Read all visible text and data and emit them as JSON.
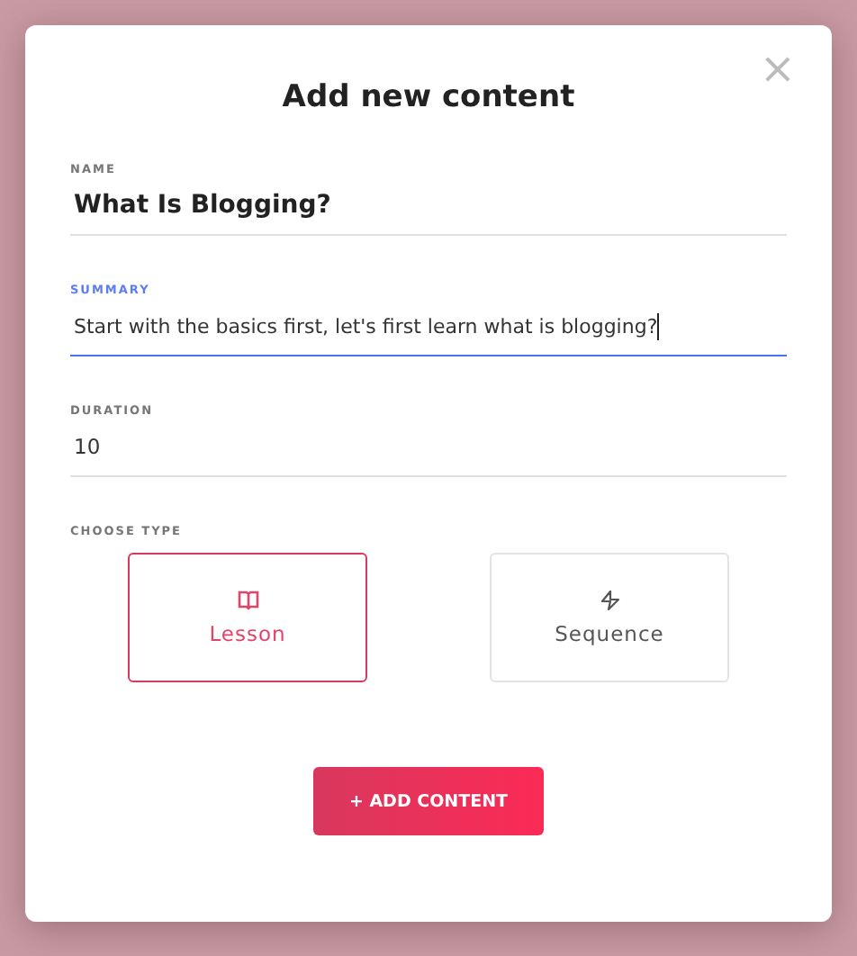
{
  "dialog": {
    "title": "Add new content",
    "close": "×"
  },
  "fields": [
    {
      "label": "NAME",
      "value": "What Is Blogging?",
      "kind": "title",
      "focused": false
    },
    {
      "label": "SUMMARY",
      "value": "Start with the basics first, let's first learn what is blogging?",
      "kind": "text",
      "focused": true
    },
    {
      "label": "DURATION",
      "value": "10",
      "kind": "text",
      "focused": false
    }
  ],
  "type_label": "CHOOSE TYPE",
  "types": [
    {
      "label": "Lesson",
      "kind": "book",
      "selected": true
    },
    {
      "label": "Sequence",
      "kind": "bolt",
      "selected": false
    }
  ],
  "submit": "+ ADD CONTENT"
}
